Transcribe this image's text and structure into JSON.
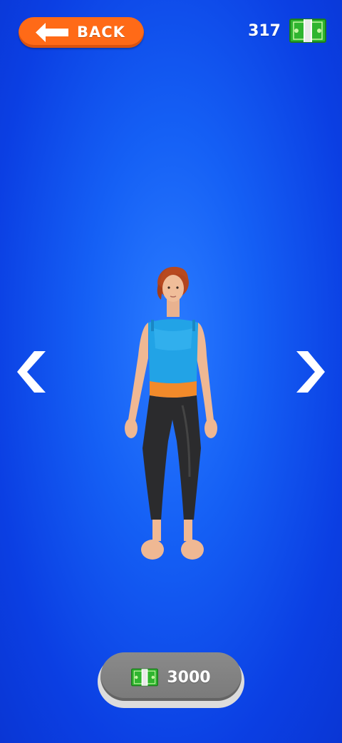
{
  "header": {
    "back_label": "BACK",
    "coins": "317"
  },
  "icons": {
    "back": "arrow-left-icon",
    "currency": "cash-bundle-icon",
    "prev": "chevron-left-icon",
    "next": "chevron-right-icon"
  },
  "shop": {
    "price": "3000"
  },
  "colors": {
    "background": "#1560f5",
    "back_button": "#ff6a17",
    "buy_button": "#7f7f7f",
    "cash": "#2fb52f"
  }
}
